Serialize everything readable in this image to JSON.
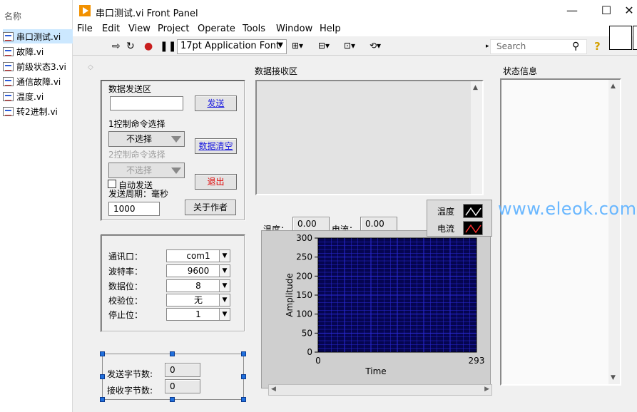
{
  "explorer": {
    "header": "名称",
    "files": [
      "串口测试.vi",
      "故障.vi",
      "前级状态3.vi",
      "通信故障.vi",
      "温度.vi",
      "转2进制.vi"
    ]
  },
  "window": {
    "title": "串口测试.vi Front Panel",
    "controls": {
      "minimize": "—",
      "maximize": "☐",
      "close": "✕"
    }
  },
  "menu": [
    "File",
    "Edit",
    "View",
    "Project",
    "Operate",
    "Tools",
    "Window",
    "Help"
  ],
  "toolbar": {
    "font": "17pt Application Font",
    "search_placeholder": "Search"
  },
  "send_section": {
    "title": "数据发送区",
    "send_value": "",
    "send_button": "发送",
    "cmd1_label": "1控制命令选择",
    "cmd1_value": "不选择",
    "clear_button": "数据清空",
    "cmd2_label": "2控制命令选择",
    "cmd2_value": "不选择",
    "exit_button": "退出",
    "auto_send_label": "自动发送",
    "period_label": "发送周期：毫秒",
    "period_value": "1000",
    "about_button": "关于作者"
  },
  "serial_section": {
    "rows": [
      {
        "label": "通讯口：",
        "value": "com1"
      },
      {
        "label": "波特率：",
        "value": "9600"
      },
      {
        "label": "数据位：",
        "value": "8"
      },
      {
        "label": "校验位：",
        "value": "无"
      },
      {
        "label": "停止位：",
        "value": "1"
      }
    ]
  },
  "bytes_section": {
    "sent_label": "发送字节数:",
    "sent_value": "0",
    "recv_label": "接收字节数:",
    "recv_value": "0"
  },
  "receive_section": {
    "title": "数据接收区"
  },
  "status_section": {
    "title": "状态信息"
  },
  "readouts": {
    "temp_label": "温度：",
    "temp_value": "0.00",
    "current_label": "电流：",
    "current_value": "0.00"
  },
  "chart_data": {
    "type": "line",
    "xlabel": "Time",
    "ylabel": "Amplitude",
    "xlim": [
      0,
      293
    ],
    "ylim": [
      0,
      300
    ],
    "xticks": [
      "0",
      "293"
    ],
    "yticks": [
      "0",
      "50",
      "100",
      "150",
      "200",
      "250",
      "300"
    ],
    "plot_background": "#050550",
    "grid": true,
    "grid_color": "#2b2bd8",
    "legend_position": "top-right",
    "series": [
      {
        "name": "温度",
        "color": "#ffffff",
        "values": []
      },
      {
        "name": "电流",
        "color": "#ff3030",
        "values": []
      }
    ]
  },
  "watermark": "www.eleok.com"
}
